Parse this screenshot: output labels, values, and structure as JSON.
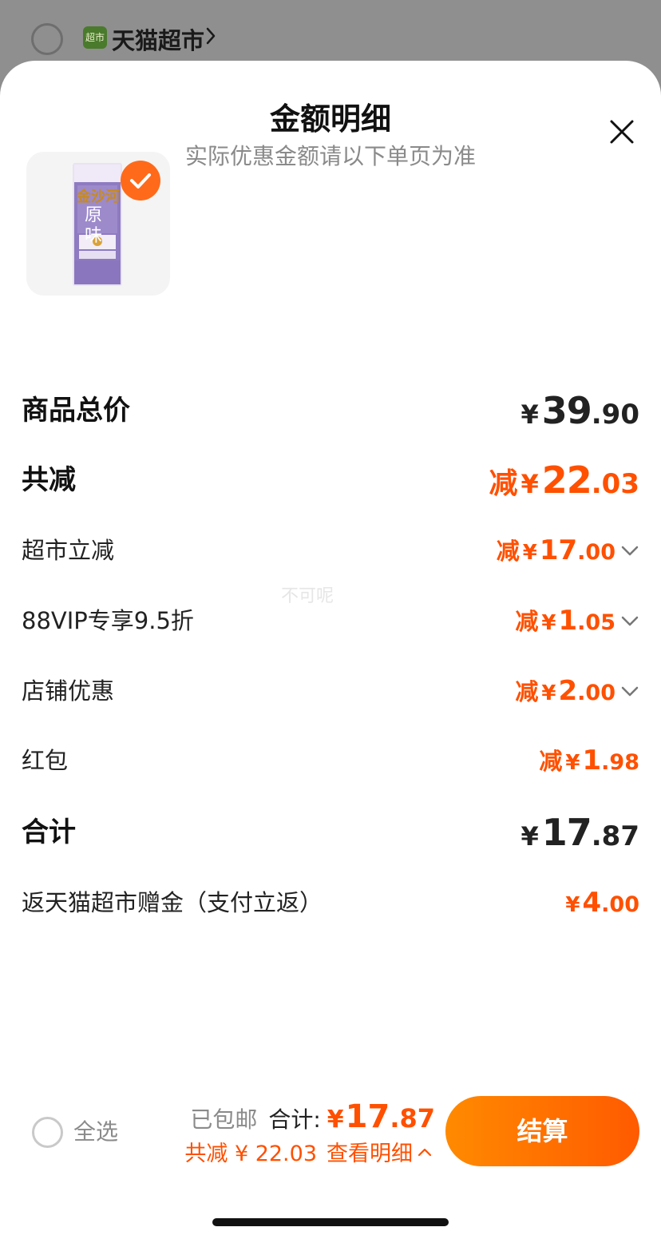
{
  "background": {
    "shop_name": "天猫超市",
    "shop_icon_text": "超市"
  },
  "sheet": {
    "title": "金额明细",
    "subtitle": "实际优惠金额请以下单页为准"
  },
  "product": {
    "brand": "金沙河",
    "flavor_line1": "原",
    "flavor_line2": "味",
    "icon": "noodle-package-image",
    "selected": true
  },
  "rows": {
    "total_price": {
      "label": "商品总价",
      "yen": "¥",
      "int": "39",
      "dec": ".90"
    },
    "total_discount": {
      "label": "共减",
      "prefix": "减",
      "yen": "¥",
      "int": "22",
      "dec": ".03"
    },
    "supermarket_discount": {
      "label": "超市立减",
      "prefix": "减",
      "yen": "¥",
      "int": "17",
      "dec": ".00"
    },
    "vip_discount": {
      "label": "88VIP专享9.5折",
      "prefix": "减",
      "yen": "¥",
      "int": "1",
      "dec": ".05"
    },
    "store_discount": {
      "label": "店铺优惠",
      "prefix": "减",
      "yen": "¥",
      "int": "2",
      "dec": ".00"
    },
    "red_packet": {
      "label": "红包",
      "prefix": "减",
      "yen": "¥",
      "int": "1",
      "dec": ".98"
    },
    "subtotal": {
      "label": "合计",
      "yen": "¥",
      "int": "17",
      "dec": ".87"
    },
    "cashback": {
      "label": "返天猫超市赠金（支付立返）",
      "yen": "¥",
      "int": "4",
      "dec": ".00"
    }
  },
  "watermark": "不可呢",
  "bottom_bar": {
    "select_all": "全选",
    "shipping": "已包邮",
    "total_label": "合计:",
    "total_yen": "¥",
    "total_int": "17",
    "total_dec": ".87",
    "discount_text": "共减 ¥ 22.03",
    "detail_link": "查看明细",
    "checkout": "结算"
  },
  "colors": {
    "accent": "#ff5000",
    "checkout_gradient_start": "#ff8a00",
    "checkout_gradient_end": "#ff5a00",
    "overlay": "#8f8f8f"
  }
}
